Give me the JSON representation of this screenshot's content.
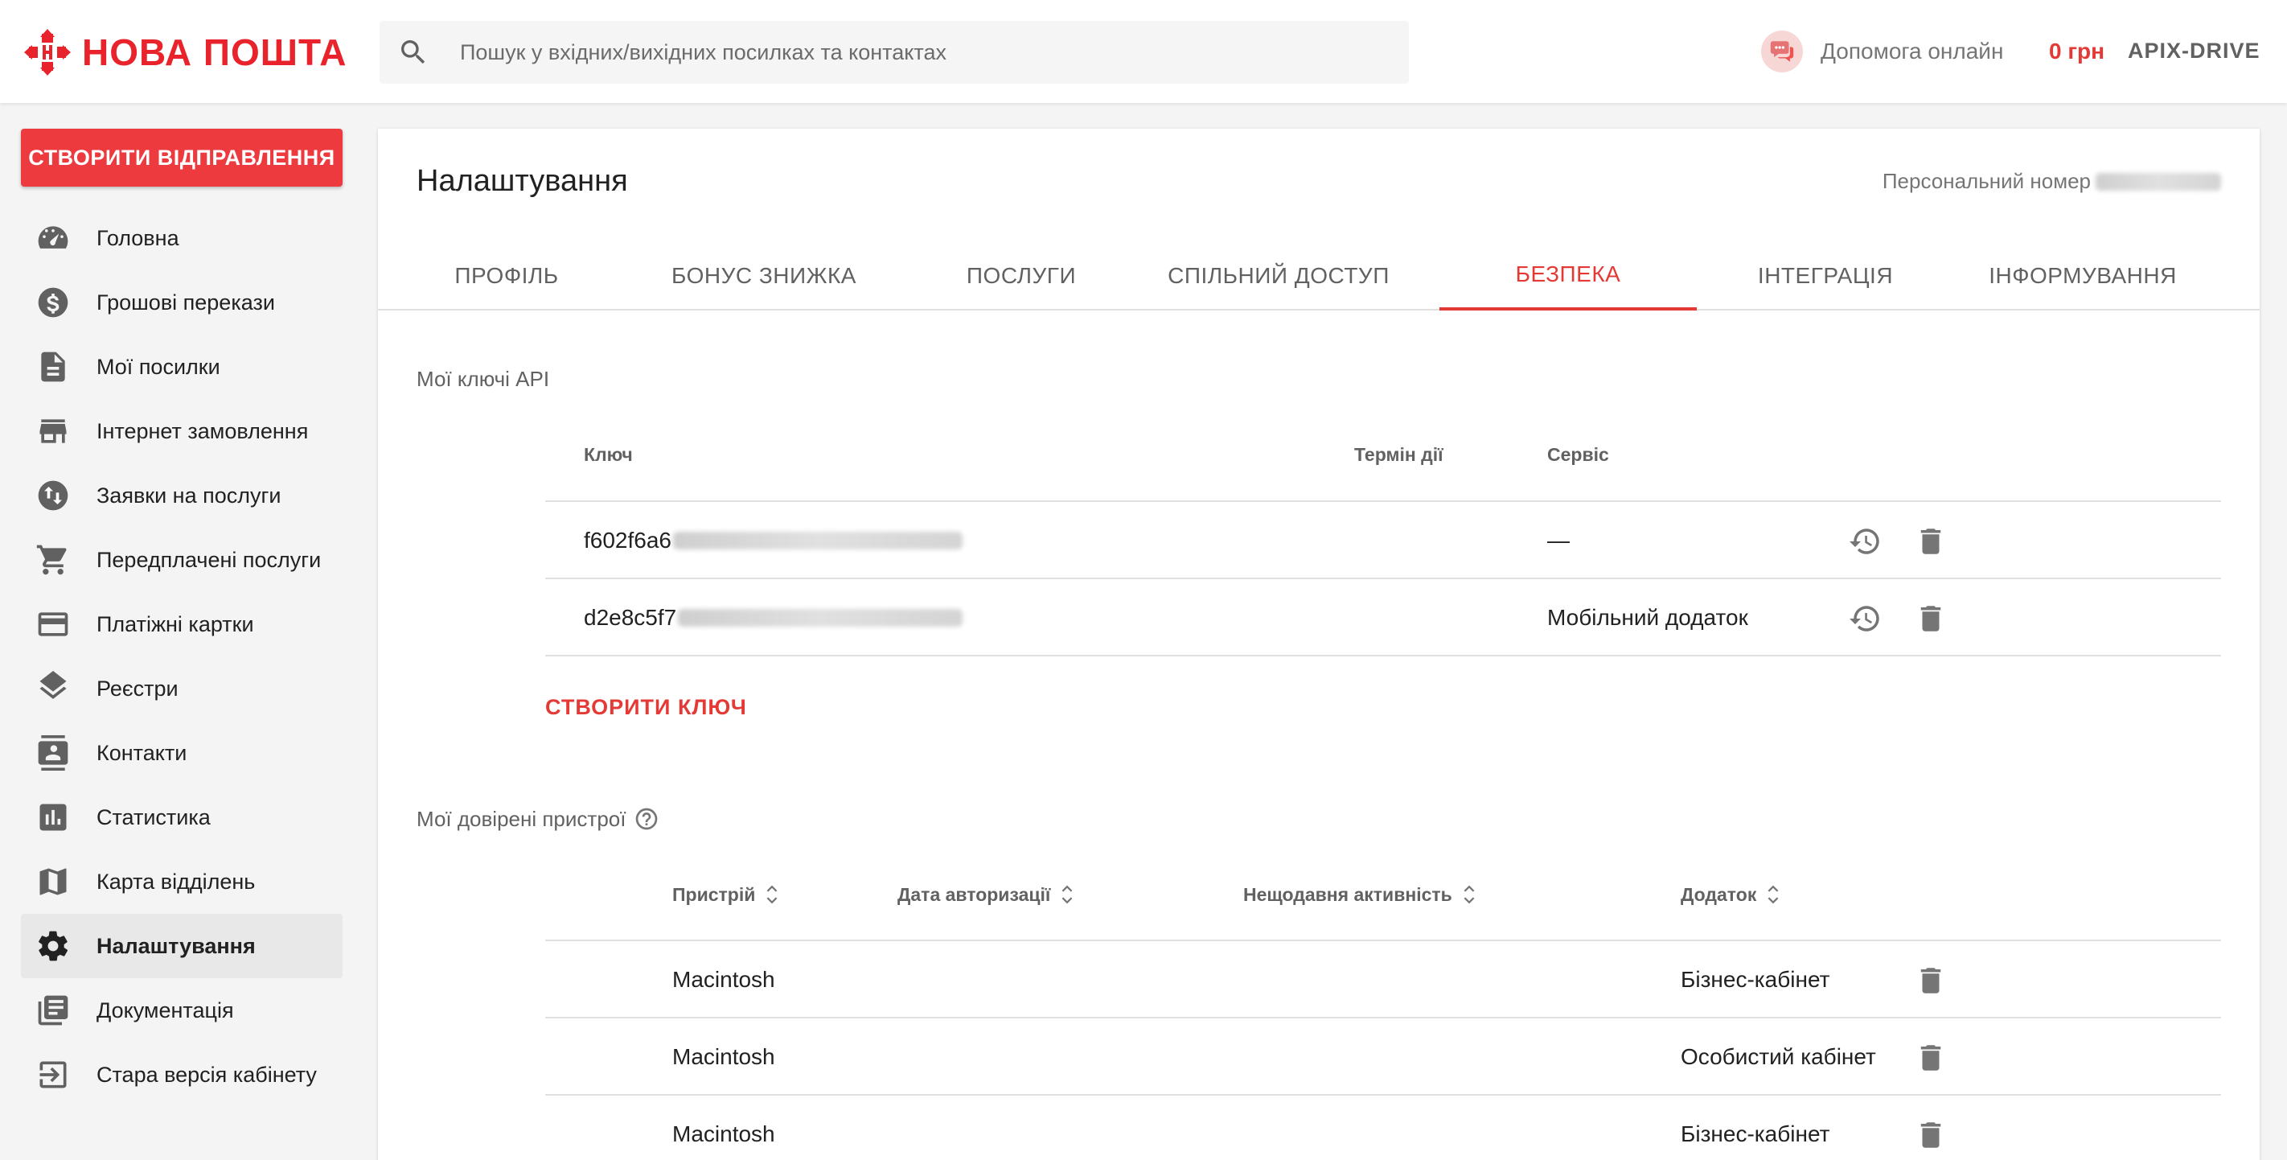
{
  "header": {
    "logo_text": "НОВА ПОШТА",
    "search_placeholder": "Пошук у вхідних/вихідних посилках та контактах",
    "help_label": "Допомога онлайн",
    "balance": "0 грн",
    "account": "APIX-DRIVE"
  },
  "sidebar": {
    "create_button": "СТВОРИТИ ВІДПРАВЛЕННЯ",
    "items": [
      {
        "label": "Головна",
        "icon": "speedometer-icon"
      },
      {
        "label": "Грошові перекази",
        "icon": "dollar-icon"
      },
      {
        "label": "Мої посилки",
        "icon": "document-icon"
      },
      {
        "label": "Інтернет замовлення",
        "icon": "store-icon"
      },
      {
        "label": "Заявки на послуги",
        "icon": "swap-icon"
      },
      {
        "label": "Передплачені послуги",
        "icon": "cart-icon"
      },
      {
        "label": "Платіжні картки",
        "icon": "credit-card-icon"
      },
      {
        "label": "Реєстри",
        "icon": "layers-icon"
      },
      {
        "label": "Контакти",
        "icon": "contacts-icon"
      },
      {
        "label": "Статистика",
        "icon": "chart-icon"
      },
      {
        "label": "Карта відділень",
        "icon": "map-icon"
      },
      {
        "label": "Налаштування",
        "icon": "gear-icon",
        "active": true
      },
      {
        "label": "Документація",
        "icon": "library-icon"
      },
      {
        "label": "Стара версія кабінету",
        "icon": "exit-icon"
      }
    ]
  },
  "main": {
    "title": "Налаштування",
    "personal_label": "Персональний номер",
    "tabs": [
      {
        "label": "ПРОФІЛЬ"
      },
      {
        "label": "БОНУС ЗНИЖКА"
      },
      {
        "label": "ПОСЛУГИ"
      },
      {
        "label": "СПІЛЬНИЙ ДОСТУП"
      },
      {
        "label": "БЕЗПЕКА",
        "active": true
      },
      {
        "label": "ІНТЕГРАЦІЯ"
      },
      {
        "label": "ІНФОРМУВАННЯ"
      }
    ],
    "api_keys": {
      "title": "Мої ключі API",
      "columns": {
        "key": "Ключ",
        "term": "Термін дії",
        "service": "Сервіс"
      },
      "rows": [
        {
          "key_prefix": "f602f6a6",
          "service": "—"
        },
        {
          "key_prefix": "d2e8c5f7",
          "service": "Мобільний додаток"
        }
      ],
      "create_label": "СТВОРИТИ КЛЮЧ"
    },
    "devices": {
      "title": "Мої довірені пристрої",
      "columns": {
        "device": "Пристрій",
        "auth_date": "Дата авторизації",
        "activity": "Нещодавня активність",
        "app": "Додаток"
      },
      "rows": [
        {
          "device": "Macintosh",
          "app": "Бізнес-кабінет"
        },
        {
          "device": "Macintosh",
          "app": "Особистий кабінет"
        },
        {
          "device": "Macintosh",
          "app": "Бізнес-кабінет"
        }
      ]
    }
  },
  "colors": {
    "brand": "#e8232b",
    "accent": "#e53935",
    "button": "#ed3a3f"
  }
}
